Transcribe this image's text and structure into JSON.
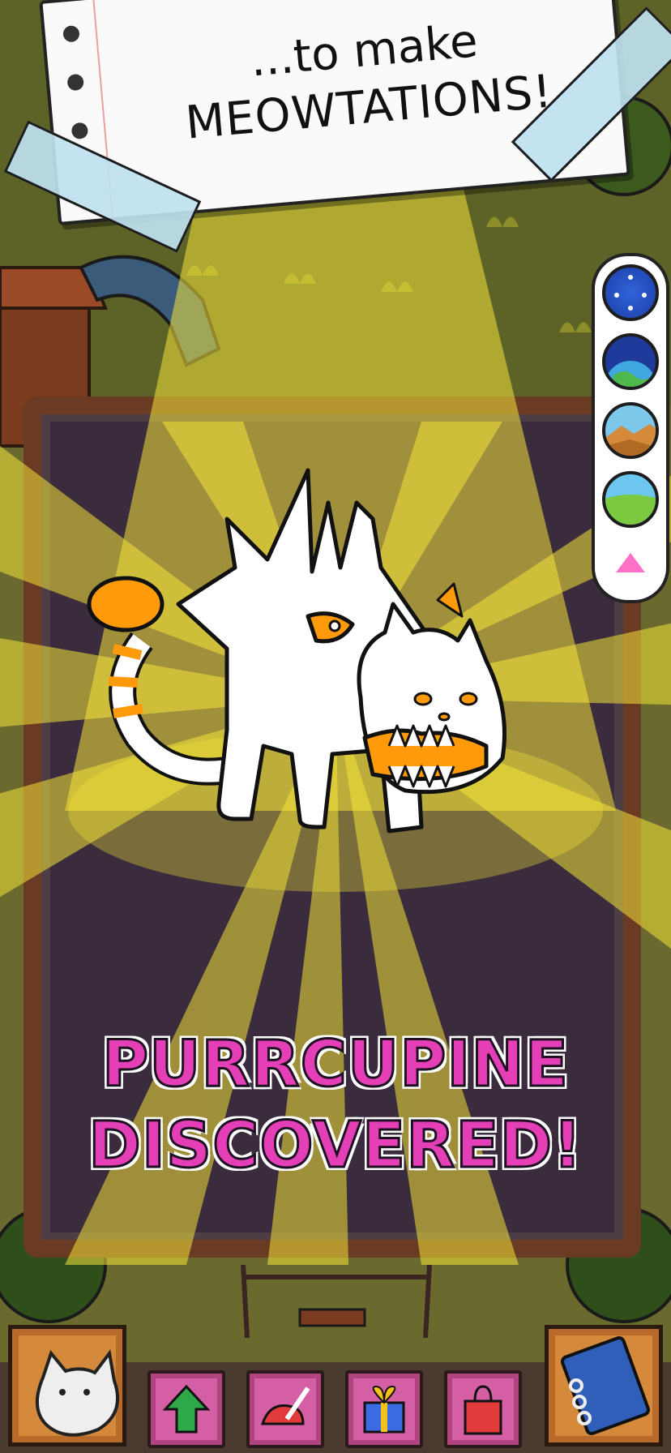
{
  "banner": {
    "line1": "...to make",
    "line2": "MEOWTATIONS!"
  },
  "discovery": {
    "line1": "PURRCUPINE",
    "line2": "DISCOVERED!"
  },
  "world_scroller": {
    "worlds": [
      "space-world",
      "earth-orbit-world",
      "desert-world",
      "meadow-world"
    ]
  },
  "toolbar": {
    "items": [
      "cat-profile",
      "upgrade",
      "customize",
      "gifts",
      "shop",
      "catalog"
    ]
  },
  "colors": {
    "title_pink": "#e53fb8",
    "spotlight": "#f2e23a",
    "background_dark": "#3a2c3c",
    "accent_orange": "#ff9a0a"
  }
}
